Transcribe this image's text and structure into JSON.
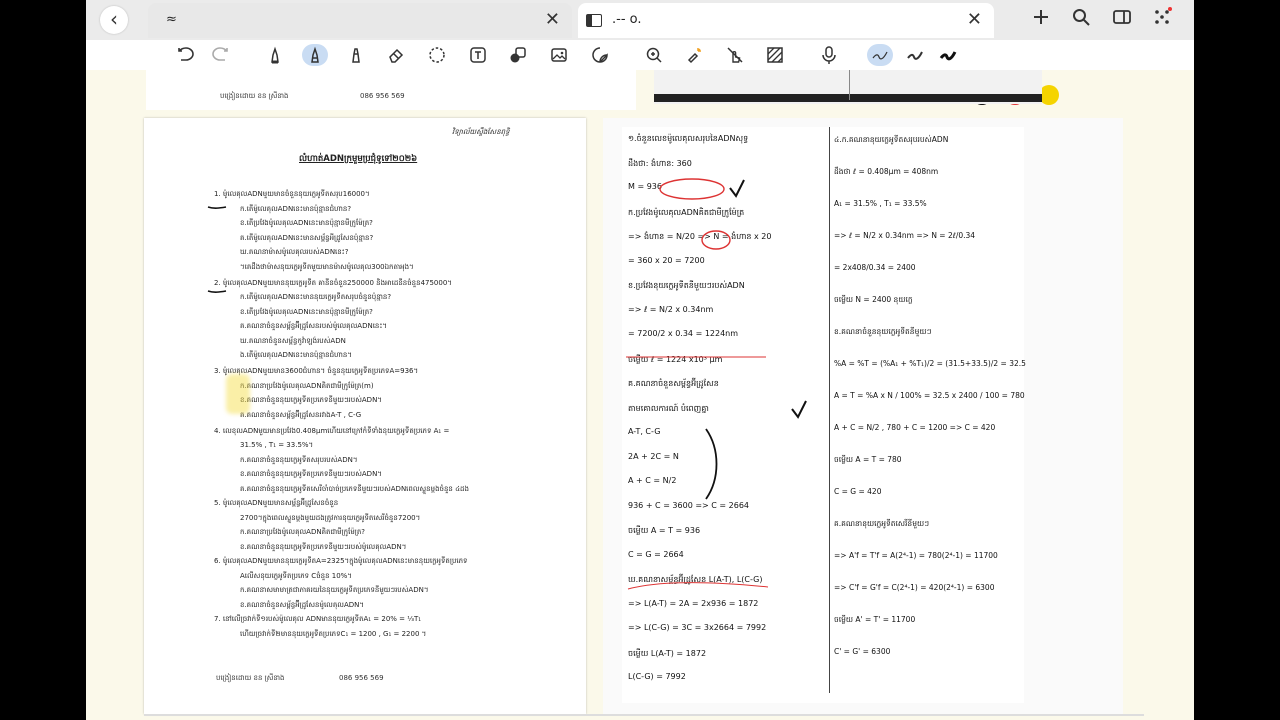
{
  "tabs": [
    {
      "title": "≈"
    },
    {
      "title": ".-- o."
    }
  ],
  "left_page": {
    "header_right": "វិទ្យាល័យស្ទឹងសែនពុទ្ធិ",
    "title": "លំហាត់ADNក្រមួមប្រជុំទូទៅ២០២៦",
    "questions": [
      "1.  ម៉ូលេគុលADNមួយមានចំនួននុយក្លេអូទីតសរុប16000។",
      "ក.តើម៉ូលេគុលADNនេះមានប៉ុន្មានជំហាន?",
      "ខ.តើប្រវែងម៉ូលេគុលADNនេះមានប៉ុន្មានមីក្រូម៉ែត្រ?",
      "គ.តើម៉ូលេគុលADNនេះមានសម្ព័ន្ធអីដ្រូសែនប៉ុន្មាន?",
      "ឃ.គណនាម៉ាសម៉ូលេគុលរបស់ADNនេះ?",
      "។គេដឹងថាម៉ាសនុយក្លេអូទីតមួយមានម៉ាសម៉ូលេគុល300ឯកតាអុង។",
      "2.  ម៉ូលេគុលADNមួយមាននុយក្លេអូទីត គានីនចំនួន250000 និងអាដេនីនចំនួន475000។",
      "ក.តើម៉ូលេគុលADNនេះមាននុយក្លេអូទីតសរុបចំនួនប៉ុន្មាន?",
      "ខ.តើប្រវែងម៉ូលេគុលADNនេះមានប៉ុន្មានមីក្រូម៉ែត្រ?",
      "គ.គណនាចំនួនសម្ព័ន្ធអ៊ីដ្រូសែនរបស់ម៉ូលេគុលADNនេះ។",
      "ឃ.គណនាចំនួនសម្ព័ន្ធកូវ៉ាឡង់របស់ADN",
      "ង.តើម៉ូលេគុលADNនេះមានប៉ុន្មានជំហាន។",
      "3.  ម៉ូលេគុលADNមួយមាន3600ជំហាន។ ចំនួននុយក្លេអូទីតប្រភេទA=936។",
      "ក.គណនាប្រវែងម៉ូលេគុលADNគិតជាមីក្រូម៉ែត្រ(m)",
      "ខ.គណនាចំនួននុយក្លេអូទីតប្រភេទនីមួយៗរបស់ADN។",
      "គ.គណនាចំនួនសម្ព័ន្ធអ៊ីដ្រូសែនរវាងA-T , C-G",
      "4.  លេខុលADNមួយមានប្រវែង0.408μmហើយនៅក្រៅកំទីទាំងនុយក្លេអូទីតប្រភេទ A₁ =",
      "31.5% , T₁ = 33.5%។",
      "ក.គណនាចំនួននុយក្លេអូទីតសរុបរបស់ADN។",
      "ខ.គណនាចំនួននុយក្លេអូទីតប្រភេទនីមួយៗរបស់ADN។",
      "គ.គណនាចំនួននុយក្លេអូទីតសេរីចាំបាច់ប្រភេទនីមួយៗរបស់ADNពេលស្ទួនម្តងចំនួន ៤ដង",
      "5.  ម៉ូលេគុលADNមួយមានសម្ព័ន្ធអ៊ីដ្រូសែនចំនួន",
      "2700។ក្នុងពេលស្ទួនម្តងមួយដងត្រូវការនុយក្លេអូទីតសេរីចំនួន7200។",
      "ក.គណនាប្រវែងម៉ូលេគុលADNគិតជាមីក្រូម៉ែត្រ?",
      "ខ.គណនាចំនួននុយក្លេអូទីតប្រភេទនីមួយៗរបស់ម៉ូលេគុលADN។",
      "6.  ម៉ូលេគុលADNមួយមាននុយក្លេអូទីតA=2325។ក្នុងម៉ូលេគុលADNនេះមាននុយក្លេអូទីតប្រភេទ",
      "Aលើសនុយក្លេអូទីតប្រភេទ Cចំនួន 10%។",
      "ក.គណនាសមាមាត្រជាភាគរយនៃនុយក្លេអូទីតប្រភេទនីមួយៗរបស់ADN។",
      "ខ.គណនាចំនួនសម្ព័ន្ធអ៊ីដ្រូសែនម៉ូលេគុលADN។",
      "7.  នៅលើច្រវាក់ទី១របស់ម៉ូលេគុល ADNមាននុយក្លេអូទីតA₁ = 20% = ⅓T₁",
      "ហើយច្រវាក់ទី២មាននុយក្លេអូទីតប្រភេទC₁ = 1200 , G₁ = 2200   ។"
    ],
    "footer_left": "បង្រៀនដោយ ខន ស្រីនាង",
    "footer_phone": "086 956 569"
  },
  "right_page": {
    "left_column": [
      "១.ចំនួនលេខម៉ូលេគុលសរុបនៃADNសុទ្ធ",
      "ដឹងថា: ងំហាន: 360",
      "M = 936",
      "ក.ប្រវែងម៉ូលេគុលADNគិតជាមីក្រូម៉ែត្រ",
      "=> ងំហាន = N/20 => N = ងំហាន x 20",
      "= 360 x 20 = 7200",
      "ខ.ប្រវែងនុយក្លេអូទីតនីមួយៗរបស់ADN",
      "=> ℓ = N/2 x 0.34nm",
      "= 7200/2 x 0.34 = 1224nm",
      "ចម្លើយ ℓ = 1224 x10³ μm",
      "គ.គណនាចំនួនសម្ព័ន្ធអ៊ីដ្រូសែន",
      "តាមគោលការណ៍ បំពេញគ្នា",
      "A-T, C-G",
      "2A + 2C = N",
      "A + C = N/2",
      "936 + C = 3600 => C = 2664",
      "ចម្លើយ A = T = 936",
      "C = G = 2664",
      "ឃ.គណនាសម្ព័ន្ធអ៊ីដ្រូសែន L(A-T), L(C-G)",
      "=> L(A-T) = 2A = 2x936 = 1872",
      "=> L(C-G) = 3C = 3x2664 = 7992",
      "ចម្លើយ L(A-T) = 1872",
      "L(C-G) = 7992"
    ],
    "right_column": [
      "៤.ក.គណនានុយក្លេអូទីតសរុបរបស់ADN",
      "ដឹងថា ℓ = 0.408μm = 408nm",
      "A₁ = 31.5% , T₁ = 33.5%",
      "=> ℓ = N/2 x 0.34nm => N = 2ℓ/0.34",
      "= 2x408/0.34 = 2400",
      "ចម្លើយ N = 2400 នុយក្លេ",
      "ខ.គណនាចំនួននុយក្លេអូទីតនីមួយៗ",
      "%A = %T = (%A₁ + %T₁)/2 = (31.5+33.5)/2 = 32.5",
      "A = T = %A x N / 100% = 32.5 x 2400 / 100 = 780",
      "A + C = N/2 , 780 + C = 1200 => C = 420",
      "ចម្លើយ A = T = 780",
      "C = G = 420",
      "គ.គណនានុយក្លេអូទីតសេរីនីមួយៗ",
      "=> A'f = T'f = A(2⁴-1) = 780(2⁴-1) = 11700",
      "=> C'f = G'f = C(2⁴-1) = 420(2⁴-1) = 6300",
      "ចម្លើយ A' = T' = 11700",
      "C' = G' = 6300"
    ]
  }
}
